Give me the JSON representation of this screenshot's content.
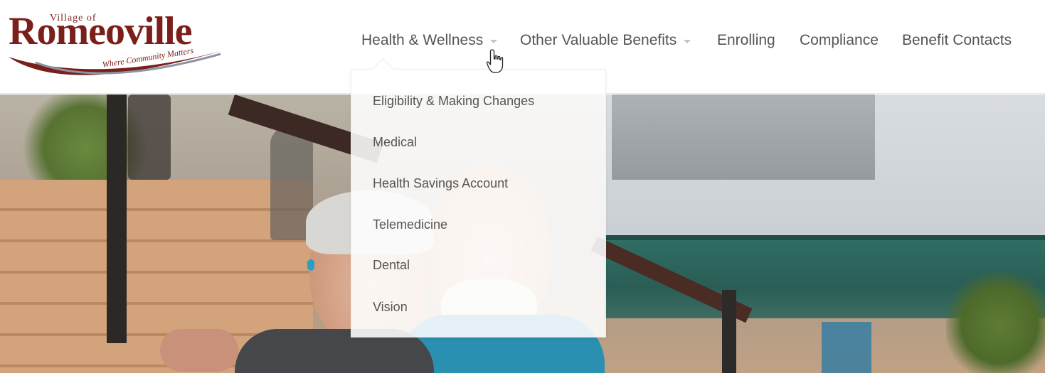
{
  "logo": {
    "village_text": "Village of",
    "name": "Romeoville",
    "tagline": "Where Community Matters"
  },
  "nav": {
    "items": [
      {
        "label": "Health & Wellness",
        "has_dropdown": true,
        "active": true
      },
      {
        "label": "Other Valuable Benefits",
        "has_dropdown": true,
        "active": false
      },
      {
        "label": "Enrolling",
        "has_dropdown": false,
        "active": false
      },
      {
        "label": "Compliance",
        "has_dropdown": false,
        "active": false
      },
      {
        "label": "Benefit Contacts",
        "has_dropdown": false,
        "active": false
      }
    ]
  },
  "dropdown": {
    "items": [
      {
        "label": "Eligibility & Making Changes"
      },
      {
        "label": "Medical"
      },
      {
        "label": "Health Savings Account"
      },
      {
        "label": "Telemedicine"
      },
      {
        "label": "Dental"
      },
      {
        "label": "Vision"
      }
    ]
  },
  "colors": {
    "brand": "#7a1f1a",
    "nav_text": "#555555",
    "caret": "#c2c2c2"
  },
  "icons": {
    "cursor": "hand-pointer-icon",
    "caret": "chevron-down-icon"
  }
}
